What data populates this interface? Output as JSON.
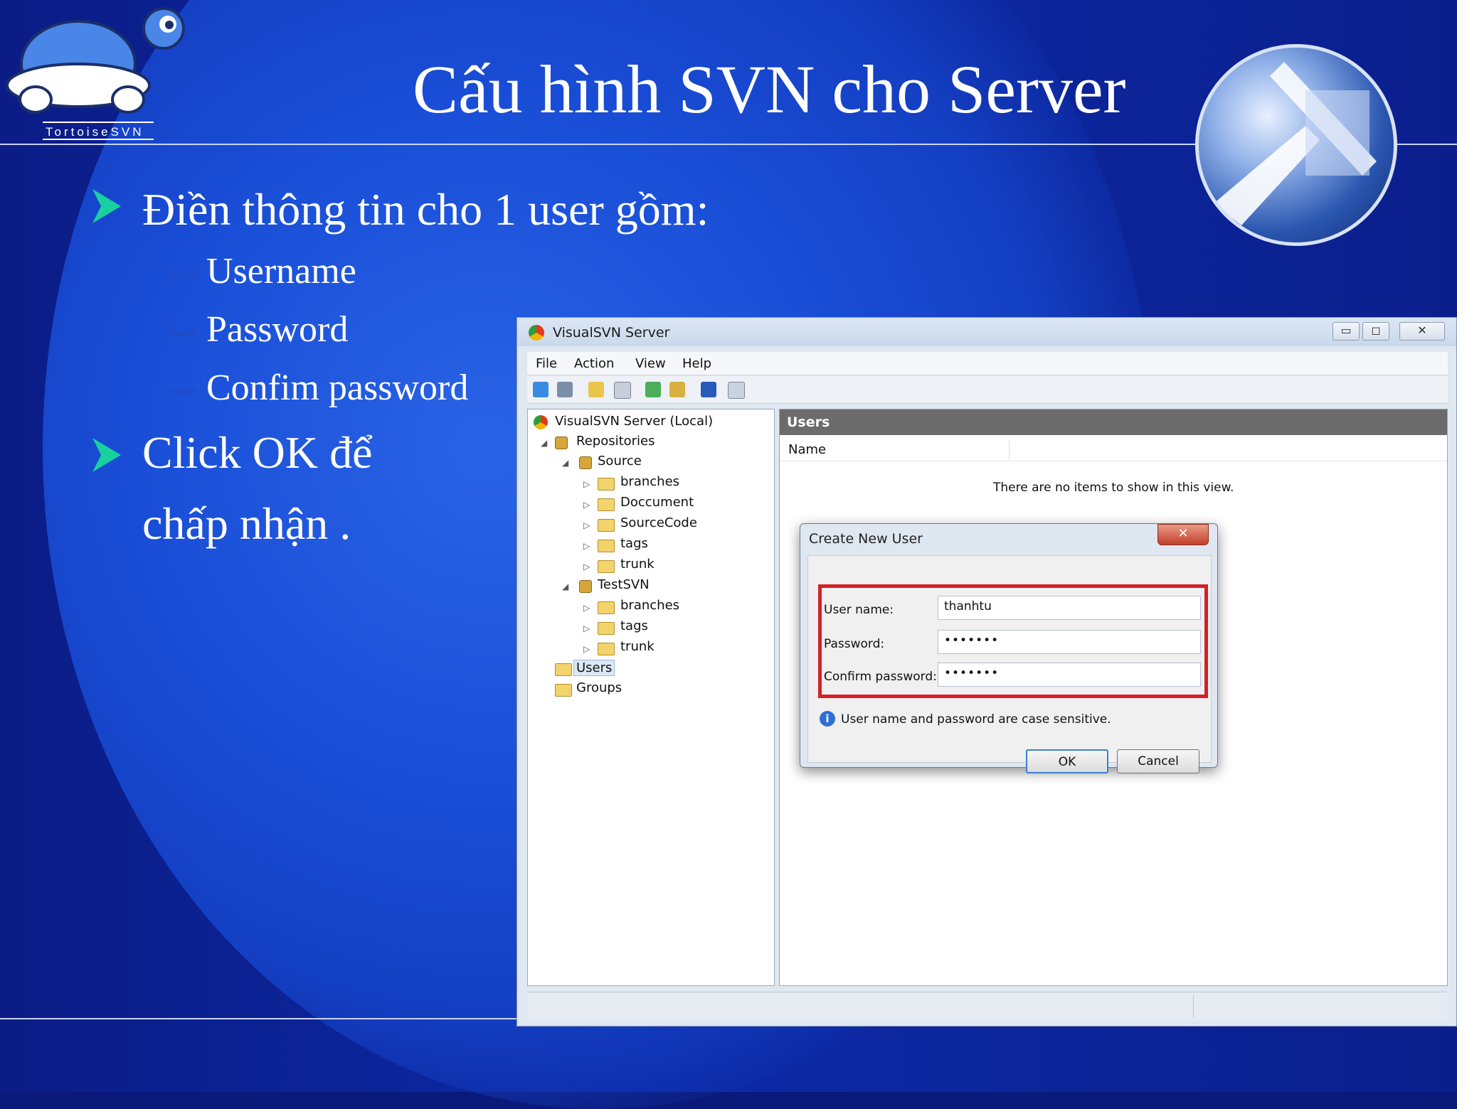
{
  "slide": {
    "title": "Cấu hình SVN cho Server",
    "logo_text": "TortoiseSVN",
    "bullet1": "Điền thông tin cho 1 user gồm:",
    "sub_items": [
      "Username",
      "Password",
      "Confim password"
    ],
    "bullet2_line1": "Click OK để",
    "bullet2_line2": "chấp nhận ."
  },
  "window": {
    "title": "VisualSVN Server",
    "menu": [
      "File",
      "Action",
      "View",
      "Help"
    ],
    "tree": {
      "root": "VisualSVN Server (Local)",
      "repositories": "Repositories",
      "source": "Source",
      "source_children": [
        "branches",
        "Doccument",
        "SourceCode",
        "tags",
        "trunk"
      ],
      "testsvn": "TestSVN",
      "testsvn_children": [
        "branches",
        "tags",
        "trunk"
      ],
      "users": "Users",
      "groups": "Groups"
    },
    "content": {
      "header": "Users",
      "column_name": "Name",
      "empty_message": "There are no items to show in this view."
    }
  },
  "dialog": {
    "title": "Create New User",
    "close": "✕",
    "username_label": "User name:",
    "username_value": "thanhtu",
    "password_label": "Password:",
    "password_value": "•••••••",
    "confirm_label": "Confirm password:",
    "confirm_value": "•••••••",
    "info": "User name and password are case sensitive.",
    "ok": "OK",
    "cancel": "Cancel"
  },
  "colors": {
    "background": "#0b1c86",
    "highlight_box": "#d61f26",
    "bullet_arrow": "#19d0a0"
  }
}
